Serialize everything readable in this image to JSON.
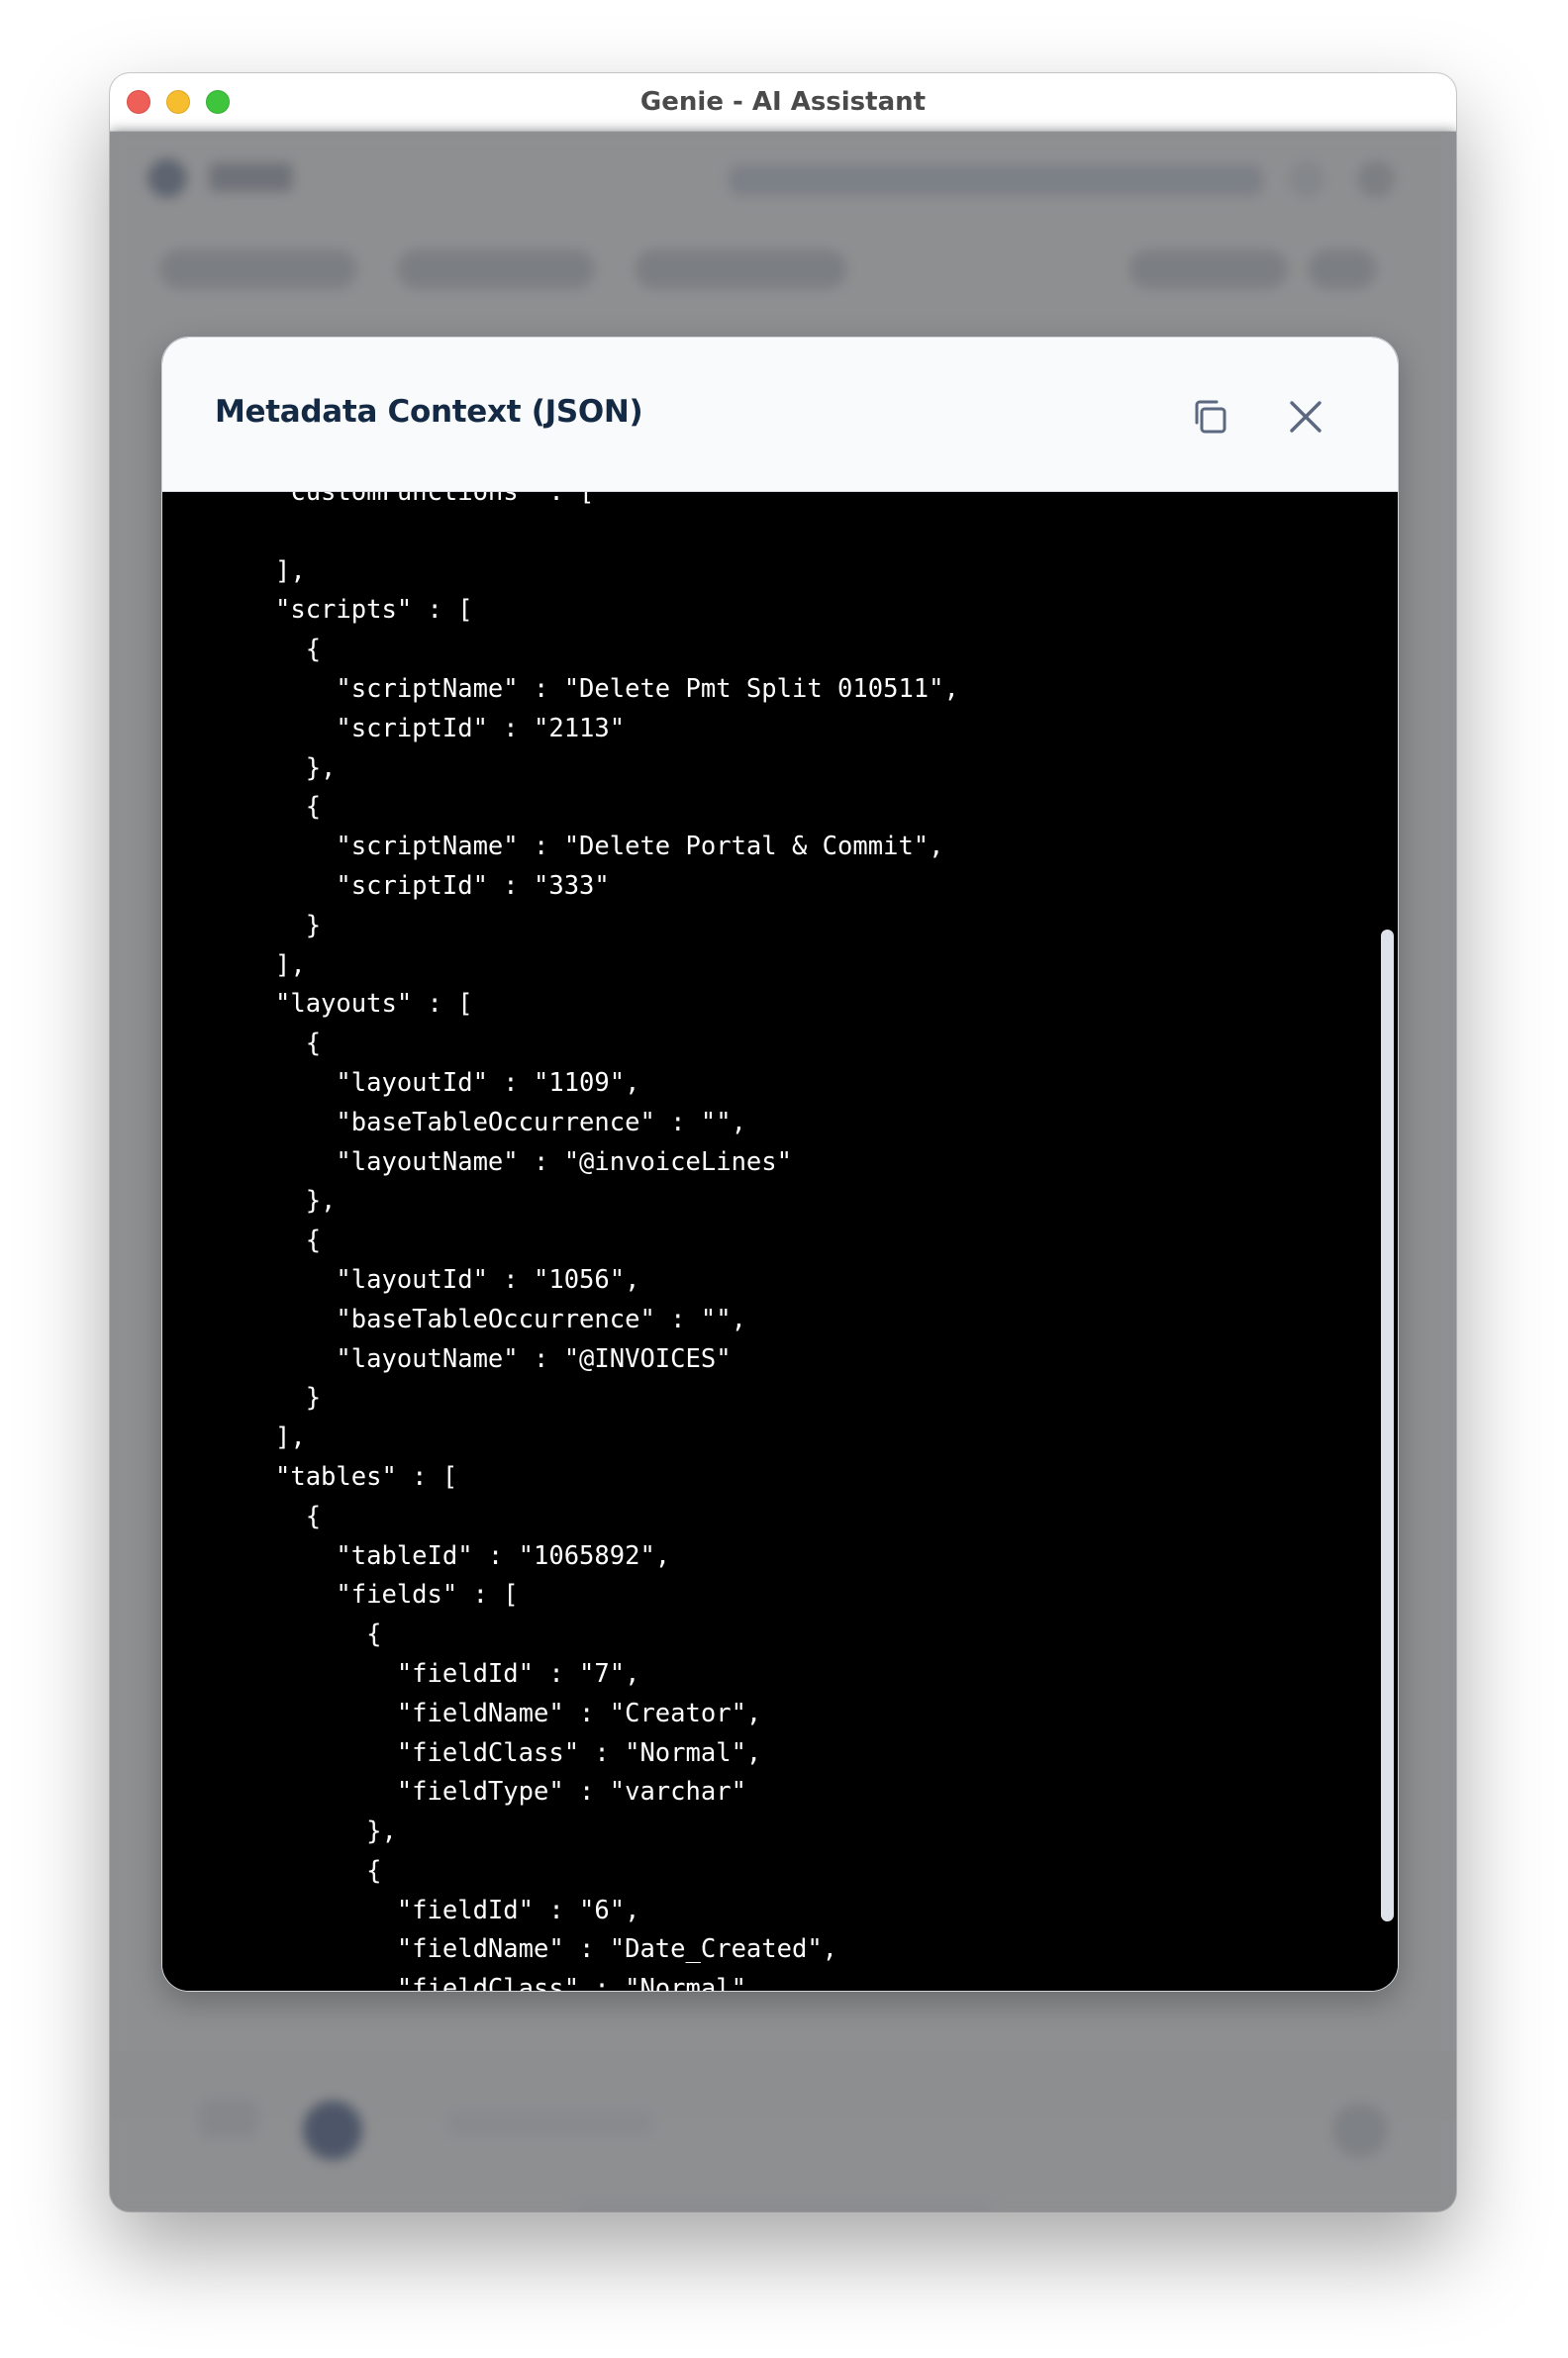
{
  "window": {
    "title": "Genie - AI Assistant"
  },
  "modal": {
    "title": "Metadata Context (JSON)",
    "copy_icon": "copy-icon",
    "close_icon": "close-icon",
    "code_lines": [
      "\"customFunctions\" : [",
      "",
      "],",
      "\"scripts\" : [",
      "  {",
      "    \"scriptName\" : \"Delete Pmt Split 010511\",",
      "    \"scriptId\" : \"2113\"",
      "  },",
      "  {",
      "    \"scriptName\" : \"Delete Portal & Commit\",",
      "    \"scriptId\" : \"333\"",
      "  }",
      "],",
      "\"layouts\" : [",
      "  {",
      "    \"layoutId\" : \"1109\",",
      "    \"baseTableOccurrence\" : \"\",",
      "    \"layoutName\" : \"@invoiceLines\"",
      "  },",
      "  {",
      "    \"layoutId\" : \"1056\",",
      "    \"baseTableOccurrence\" : \"\",",
      "    \"layoutName\" : \"@INVOICES\"",
      "  }",
      "],",
      "\"tables\" : [",
      "  {",
      "    \"tableId\" : \"1065892\",",
      "    \"fields\" : [",
      "      {",
      "        \"fieldId\" : \"7\",",
      "        \"fieldName\" : \"Creator\",",
      "        \"fieldClass\" : \"Normal\",",
      "        \"fieldType\" : \"varchar\"",
      "      },",
      "      {",
      "        \"fieldId\" : \"6\",",
      "        \"fieldName\" : \"Date_Created\",",
      "        \"fieldClass\" : \"Normal\","
    ]
  }
}
